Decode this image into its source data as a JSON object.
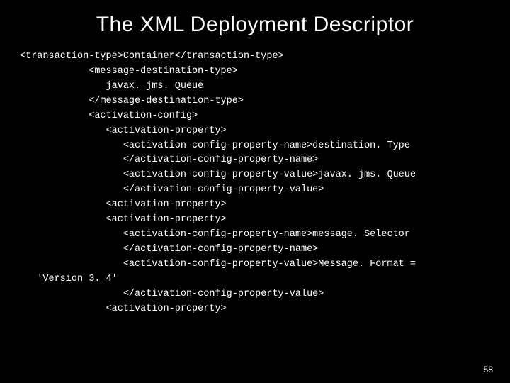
{
  "title": "The XML Deployment Descriptor",
  "code_lines": [
    "<transaction-type>Container</transaction-type>",
    "            <message-destination-type>",
    "               javax. jms. Queue",
    "            </message-destination-type>",
    "            <activation-config>",
    "               <activation-property>",
    "                  <activation-config-property-name>destination. Type",
    "                  </activation-config-property-name>",
    "                  <activation-config-property-value>javax. jms. Queue",
    "                  </activation-config-property-value>",
    "               <activation-property>",
    "               <activation-property>",
    "                  <activation-config-property-name>message. Selector",
    "                  </activation-config-property-name>",
    "                  <activation-config-property-value>Message. Format =",
    "   'Version 3. 4'",
    "                  </activation-config-property-value>",
    "               <activation-property>"
  ],
  "page_number": "58"
}
